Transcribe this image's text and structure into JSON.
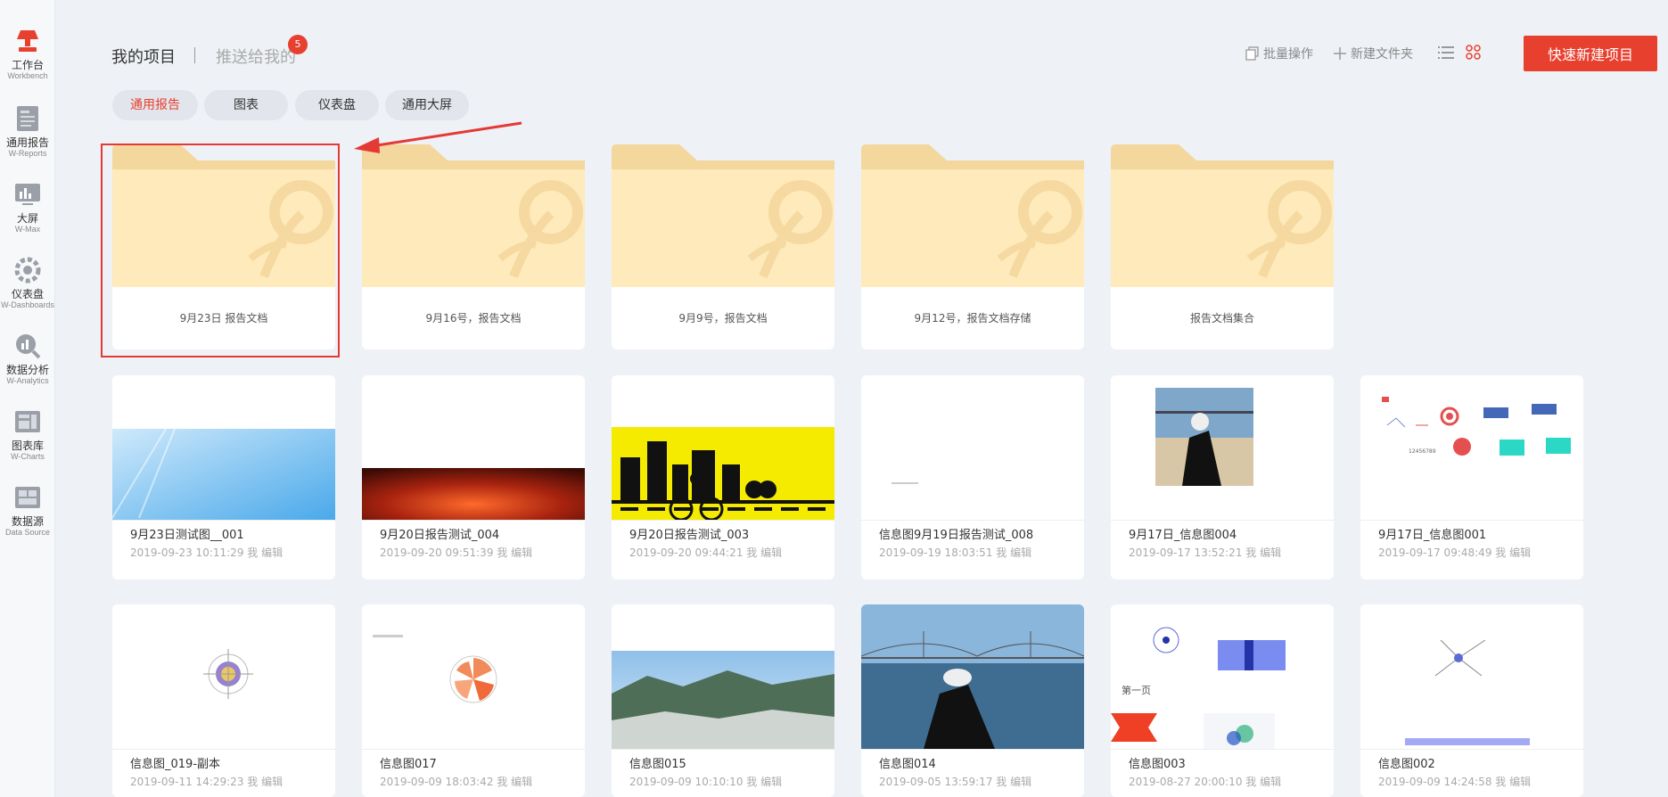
{
  "sidebar": {
    "items": [
      {
        "cn": "工作台",
        "en": "Workbench",
        "icon": "workbench-icon"
      },
      {
        "cn": "通用报告",
        "en": "W-Reports",
        "icon": "report-icon"
      },
      {
        "cn": "大屏",
        "en": "W-Max",
        "icon": "screen-icon"
      },
      {
        "cn": "仪表盘",
        "en": "W-Dashboards",
        "icon": "dashboard-icon"
      },
      {
        "cn": "数据分析",
        "en": "W-Analytics",
        "icon": "analytics-icon"
      },
      {
        "cn": "图表库",
        "en": "W-Charts",
        "icon": "charts-icon"
      },
      {
        "cn": "数据源",
        "en": "Data Source",
        "icon": "datasource-icon"
      }
    ]
  },
  "header": {
    "tab_mine": "我的项目",
    "tab_pushed": "推送给我的",
    "badge_count": "5",
    "batch_label": "批量操作",
    "new_folder_label": "新建文件夹",
    "new_project_label": "快速新建项目"
  },
  "categories": [
    "通用报告",
    "图表",
    "仪表盘",
    "通用大屏"
  ],
  "active_category": "通用报告",
  "folders": [
    {
      "name": "9月23日 报告文档"
    },
    {
      "name": "9月16号，报告文档"
    },
    {
      "name": "9月9号，报告文档"
    },
    {
      "name": "9月12号，报告文档存储"
    },
    {
      "name": "报告文档集合"
    }
  ],
  "projects": [
    {
      "title": "9月23日测试图__001",
      "meta": "2019-09-23 10:11:29 我 编辑"
    },
    {
      "title": "9月20日报告测试_004",
      "meta": "2019-09-20 09:51:39 我 编辑"
    },
    {
      "title": "9月20日报告测试_003",
      "meta": "2019-09-20 09:44:21 我 编辑"
    },
    {
      "title": "信息图9月19日报告测试_008",
      "meta": "2019-09-19 18:03:51 我 编辑"
    },
    {
      "title": "9月17日_信息图004",
      "meta": "2019-09-17 13:52:21 我 编辑"
    },
    {
      "title": "9月17日_信息图001",
      "meta": "2019-09-17 09:48:49 我 编辑"
    },
    {
      "title": "信息图_019-副本",
      "meta": "2019-09-11 14:29:23 我 编辑"
    },
    {
      "title": "信息图017",
      "meta": "2019-09-09 18:03:42 我 编辑"
    },
    {
      "title": "信息图015",
      "meta": "2019-09-09 10:10:10 我 编辑"
    },
    {
      "title": "信息图014",
      "meta": "2019-09-05 13:59:17 我 编辑"
    },
    {
      "title": "信息图003",
      "meta": "2019-08-27 20:00:10 我 编辑"
    },
    {
      "title": "信息图002",
      "meta": "2019-09-09 14:24:58 我 编辑"
    }
  ],
  "thumb_texts": {
    "page_one": "第一页",
    "number": "12456789"
  },
  "colors": {
    "accent": "#e8402f",
    "folder": "#feeabb",
    "folder_tab": "#f3d79c"
  }
}
